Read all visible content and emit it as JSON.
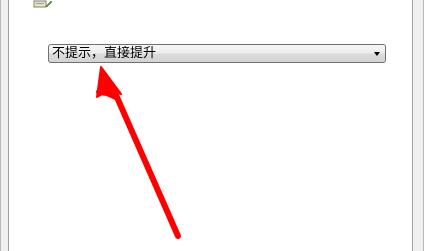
{
  "dropdown": {
    "selected": "不提示，直接提升"
  },
  "icons": {
    "top": "config-icon",
    "dropdown_arrow": "chevron-down-icon",
    "annotation": "red-arrow-icon"
  },
  "colors": {
    "annotation": "#ff0000",
    "combo_border": "#707070"
  }
}
